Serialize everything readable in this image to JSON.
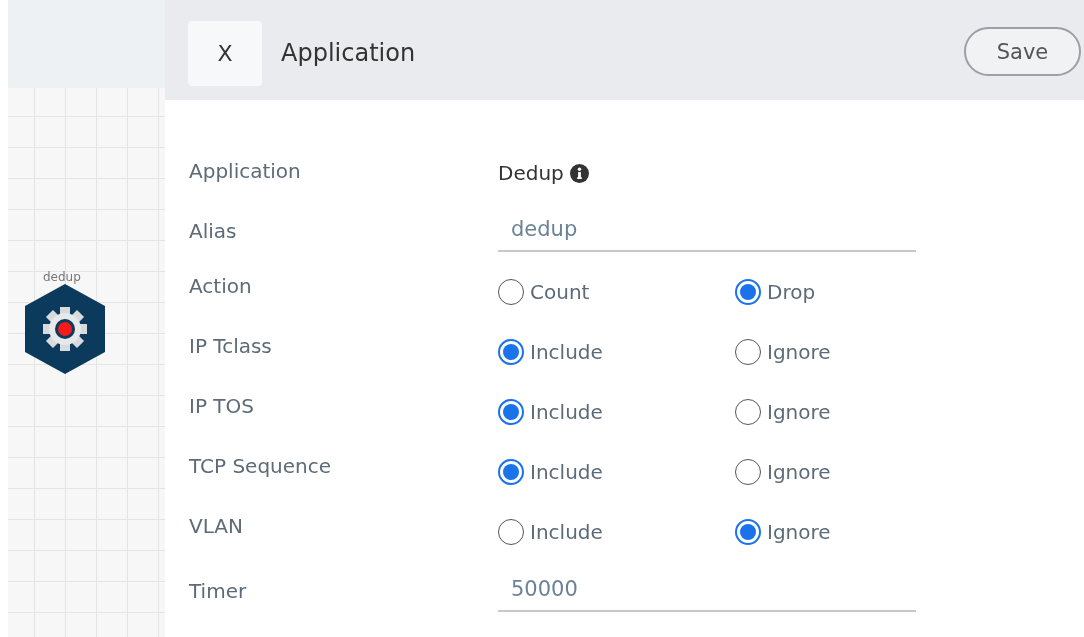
{
  "canvas": {
    "node": {
      "label": "dedup"
    }
  },
  "panel": {
    "close_button": "X",
    "title": "Application",
    "save_button": "Save",
    "fields": [
      {
        "kind": "text",
        "label": "Application",
        "value": "Dedup"
      },
      {
        "kind": "input",
        "label": "Alias",
        "value": "dedup"
      },
      {
        "kind": "radio",
        "label": "Action",
        "options": [
          {
            "label": "Count",
            "selected": false
          },
          {
            "label": "Drop",
            "selected": true
          }
        ]
      },
      {
        "kind": "radio",
        "label": "IP Tclass",
        "options": [
          {
            "label": "Include",
            "selected": true
          },
          {
            "label": "Ignore",
            "selected": false
          }
        ]
      },
      {
        "kind": "radio",
        "label": "IP TOS",
        "options": [
          {
            "label": "Include",
            "selected": true
          },
          {
            "label": "Ignore",
            "selected": false
          }
        ]
      },
      {
        "kind": "radio",
        "label": "TCP Sequence",
        "options": [
          {
            "label": "Include",
            "selected": true
          },
          {
            "label": "Ignore",
            "selected": false
          }
        ]
      },
      {
        "kind": "radio",
        "label": "VLAN",
        "options": [
          {
            "label": "Include",
            "selected": false
          },
          {
            "label": "Ignore",
            "selected": true
          }
        ]
      },
      {
        "kind": "input",
        "label": "Timer",
        "value": "50000"
      }
    ]
  }
}
